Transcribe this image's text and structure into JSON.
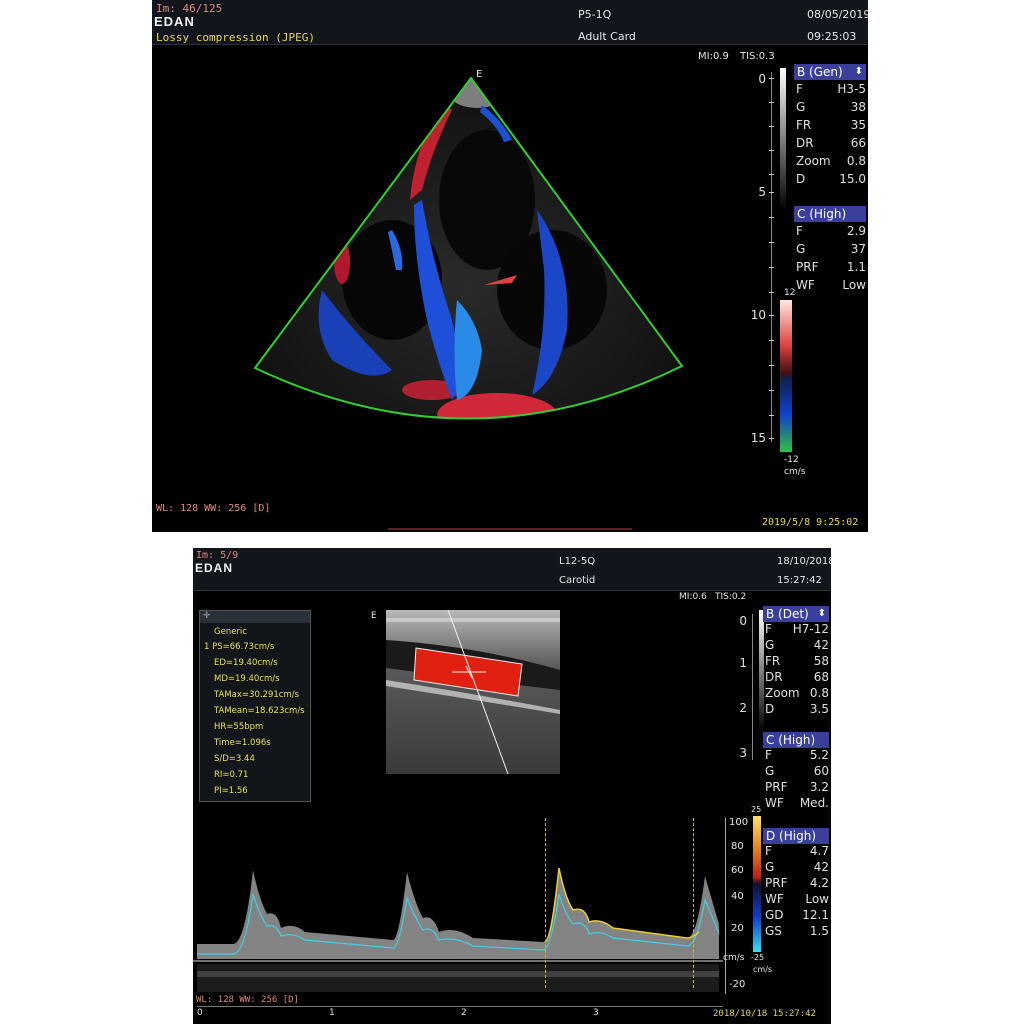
{
  "screen1": {
    "image_counter": "Im: 46/125",
    "logo": "EDAN",
    "compression_note": "Lossy compression (JPEG)",
    "probe": "P5-1Q",
    "exam_preset": "Adult Card",
    "date": "08/05/2019",
    "time": "09:25:03",
    "mi": "MI:0.9",
    "tis": "TIS:0.3",
    "orientation_marker": "E",
    "b_mode": {
      "header": "B (Gen)",
      "rows": [
        {
          "k": "F",
          "v": "H3-5"
        },
        {
          "k": "G",
          "v": "38"
        },
        {
          "k": "FR",
          "v": "35"
        },
        {
          "k": "DR",
          "v": "66"
        },
        {
          "k": "Zoom",
          "v": "0.8"
        },
        {
          "k": "D",
          "v": "15.0"
        }
      ]
    },
    "c_mode": {
      "header": "C (High)",
      "rows": [
        {
          "k": "F",
          "v": "2.9"
        },
        {
          "k": "G",
          "v": "37"
        },
        {
          "k": "PRF",
          "v": "1.1"
        },
        {
          "k": "WF",
          "v": "Low"
        }
      ]
    },
    "depth_scale": [
      "0",
      "5",
      "10",
      "15"
    ],
    "color_bar_top": "12",
    "color_bar_bottom": "-12",
    "color_bar_unit": "cm/s",
    "window_level": "WL: 128 WW: 256 [D]",
    "timestamp": "2019/5/8 9:25:02",
    "colors": {
      "sector_outline": "#33cc33",
      "doppler_red": "#e0303a",
      "doppler_blue": "#2060e8"
    }
  },
  "screen2": {
    "image_counter": "Im: 5/9",
    "logo": "EDAN",
    "probe": "L12-5Q",
    "exam_preset": "Carotid",
    "date": "18/10/2018",
    "time": "15:27:42",
    "mi": "MI:0.6",
    "tis": "TIS:0.2",
    "orientation_marker": "E",
    "measurements": {
      "title": "Generic",
      "items": [
        "1  PS=66.73cm/s",
        "ED=19.40cm/s",
        "MD=19.40cm/s",
        "TAMax=30.291cm/s",
        "TAMean=18.623cm/s",
        "HR=55bpm",
        "Time=1.096s",
        "S/D=3.44",
        "RI=0.71",
        "PI=1.56"
      ]
    },
    "b_mode": {
      "header": "B (Det)",
      "rows": [
        {
          "k": "F",
          "v": "H7-12"
        },
        {
          "k": "G",
          "v": "42"
        },
        {
          "k": "FR",
          "v": "58"
        },
        {
          "k": "DR",
          "v": "68"
        },
        {
          "k": "Zoom",
          "v": "0.8"
        },
        {
          "k": "D",
          "v": "3.5"
        }
      ]
    },
    "c_mode": {
      "header": "C (High)",
      "rows": [
        {
          "k": "F",
          "v": "5.2"
        },
        {
          "k": "G",
          "v": "60"
        },
        {
          "k": "PRF",
          "v": "3.2"
        },
        {
          "k": "WF",
          "v": "Med."
        }
      ]
    },
    "d_mode": {
      "header": "D (High)",
      "rows": [
        {
          "k": "F",
          "v": "4.7"
        },
        {
          "k": "G",
          "v": "42"
        },
        {
          "k": "PRF",
          "v": "4.2"
        },
        {
          "k": "WF",
          "v": "Low"
        },
        {
          "k": "GD",
          "v": "12.1"
        },
        {
          "k": "GS",
          "v": "1.5"
        }
      ]
    },
    "depth_scale": [
      "0",
      "1",
      "2",
      "3"
    ],
    "velocity_scale": [
      "100",
      "80",
      "60",
      "40",
      "20",
      "-20"
    ],
    "velocity_unit": "cm/s",
    "color_bar_top": "25",
    "color_bar_bottom": "-25",
    "color_bar_unit": "cm/s",
    "time_scale": [
      "0",
      "1",
      "2",
      "3"
    ],
    "window_level": "WL: 128 WW: 256 [D]",
    "timestamp": "2018/10/18 15:27:42",
    "colors": {
      "trace_yellow": "#e8d030",
      "trace_cyan": "#40d0e8",
      "color_box": "#e02010"
    }
  }
}
